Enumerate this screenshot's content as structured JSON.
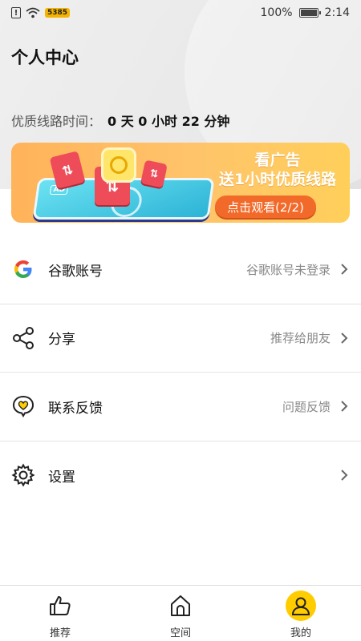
{
  "status_bar": {
    "battery_text": "100%",
    "time": "2:14",
    "badge": "5385",
    "battery_level": 1.0
  },
  "page": {
    "title": "个人中心"
  },
  "quality_line": {
    "label": "优质线路时间：",
    "value": "0 天 0 小时 22 分钟"
  },
  "banner": {
    "ad_tag": "AD",
    "headline_1": "看广告",
    "headline_2": "送1小时优质线路",
    "cta_label": "点击观看(2/2)",
    "colors": {
      "start": "#ffb35a",
      "end": "#ffcf5a",
      "cta": "#f26a2a"
    }
  },
  "menu": {
    "items": [
      {
        "label": "谷歌账号",
        "hint": "谷歌账号未登录",
        "icon": "google-icon"
      },
      {
        "label": "分享",
        "hint": "推荐给朋友",
        "icon": "share-icon"
      },
      {
        "label": "联系反馈",
        "hint": "问题反馈",
        "icon": "feedback-heart-icon"
      },
      {
        "label": "设置",
        "hint": "",
        "icon": "gear-icon"
      }
    ]
  },
  "tabbar": {
    "tabs": [
      {
        "label": "推荐",
        "icon": "thumbs-up-icon",
        "active": false
      },
      {
        "label": "空间",
        "icon": "home-icon",
        "active": false
      },
      {
        "label": "我的",
        "icon": "user-icon",
        "active": true
      }
    ],
    "accent": "#ffcc00"
  }
}
